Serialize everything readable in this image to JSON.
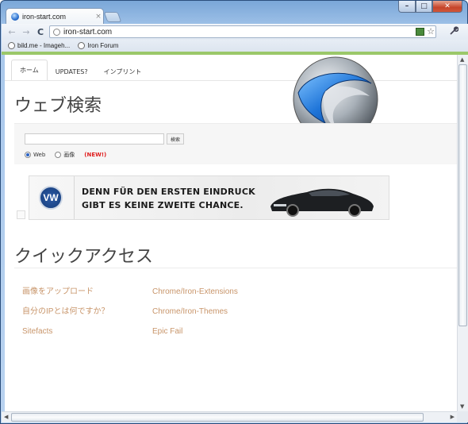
{
  "window": {
    "tab_title": "iron-start.com",
    "tab_close": "×",
    "min": "–",
    "max": "□",
    "close": "✕"
  },
  "toolbar": {
    "back": "←",
    "forward": "→",
    "reload": "C",
    "url": "iron-start.com",
    "star": "☆",
    "wrench": "🔧"
  },
  "bookmarks": [
    {
      "label": "bild.me - Imageh...",
      "icon": "globe-icon"
    },
    {
      "label": "Iron Forum",
      "icon": "globe-icon"
    }
  ],
  "nav": {
    "tabs": [
      "ホーム",
      "UPDATES?",
      "インプリント"
    ]
  },
  "search": {
    "heading": "ウェブ検索",
    "button": "検索",
    "radio_web": "Web",
    "radio_image": "画像",
    "new_badge": "(NEW!)"
  },
  "ad": {
    "line1": "DENN FÜR DEN ERSTEN EINDRUCK",
    "line2": "GIBT ES KEINE ZWEITE CHANCE.",
    "logo": "VW"
  },
  "quick": {
    "heading": "クイックアクセス",
    "col1": [
      "画像をアップロード",
      "自分のIPとは何ですか？",
      "Sitefacts"
    ],
    "col2": [
      "Chrome/Iron-Extensions",
      "Chrome/Iron-Themes",
      "Epic Fail"
    ]
  },
  "colors": {
    "link": "#c8956a",
    "accent_strip": "#9bc86a",
    "new_badge": "#e02020"
  }
}
